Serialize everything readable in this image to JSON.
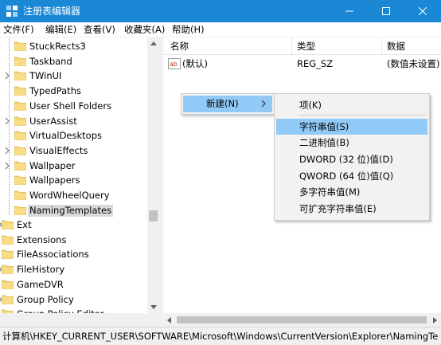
{
  "window": {
    "title": "注册表编辑器"
  },
  "menu": [
    "文件(F)",
    "编辑(E)",
    "查看(V)",
    "收藏夹(A)",
    "帮助(H)"
  ],
  "tree": {
    "items": [
      {
        "label": "StuckRects3",
        "expander": false
      },
      {
        "label": "Taskband",
        "expander": false
      },
      {
        "label": "TWinUI",
        "expander": true
      },
      {
        "label": "TypedPaths",
        "expander": false
      },
      {
        "label": "User Shell Folders",
        "expander": false
      },
      {
        "label": "UserAssist",
        "expander": true
      },
      {
        "label": "VirtualDesktops",
        "expander": false
      },
      {
        "label": "VisualEffects",
        "expander": true
      },
      {
        "label": "Wallpaper",
        "expander": true
      },
      {
        "label": "Wallpapers",
        "expander": false
      },
      {
        "label": "WordWheelQuery",
        "expander": false
      },
      {
        "label": "NamingTemplates",
        "expander": false,
        "selected": true
      }
    ],
    "root_items": [
      {
        "label": "Ext",
        "expander": true
      },
      {
        "label": "Extensions",
        "expander": false
      },
      {
        "label": "FileAssociations",
        "expander": false
      },
      {
        "label": "FileHistory",
        "expander": true
      },
      {
        "label": "GameDVR",
        "expander": false
      },
      {
        "label": "Group Policy",
        "expander": true
      },
      {
        "label": "Group Policy Editor",
        "expander": false
      }
    ]
  },
  "list": {
    "columns": [
      "名称",
      "类型",
      "数据"
    ],
    "rows": [
      {
        "name": "(默认)",
        "type": "REG_SZ",
        "data": "(数值未设置)"
      }
    ]
  },
  "context_menu": {
    "parent_label": "新建(N)",
    "submenu": [
      {
        "label": "项(K)"
      },
      {
        "label": "字符串值(S)",
        "highlighted": true
      },
      {
        "label": "二进制值(B)"
      },
      {
        "label": "DWORD (32 位)值(D)"
      },
      {
        "label": "QWORD (64 位)值(Q)"
      },
      {
        "label": "多字符串值(M)"
      },
      {
        "label": "可扩充字符串值(E)"
      }
    ]
  },
  "statusbar": {
    "path": "计算机\\HKEY_CURRENT_USER\\SOFTWARE\\Microsoft\\Windows\\CurrentVersion\\Explorer\\NamingTe"
  },
  "colors": {
    "titlebar": "#1b88d6",
    "highlight": "#91c9f7",
    "folder": "#f5d67a"
  },
  "icons": [
    "regedit-icon",
    "minimize-icon",
    "maximize-icon",
    "close-icon",
    "folder-icon",
    "expand-arrow-icon",
    "string-value-icon",
    "submenu-arrow-icon"
  ]
}
